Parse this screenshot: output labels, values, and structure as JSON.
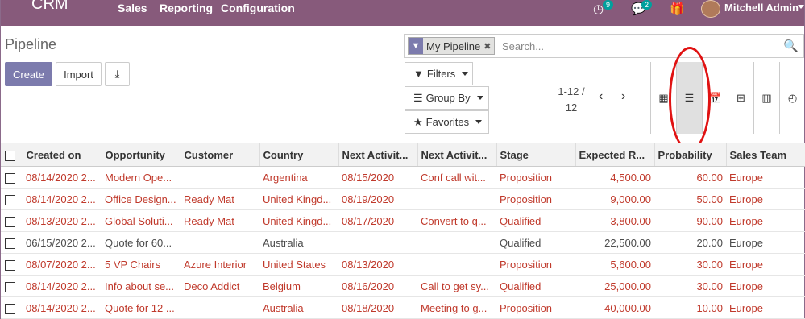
{
  "nav": {
    "brand": "CRM",
    "menus": [
      "Sales",
      "Reporting",
      "Configuration"
    ],
    "activity_badge": "9",
    "message_badge": "2",
    "user_name": "Mitchell Admin"
  },
  "control": {
    "title": "Pipeline",
    "create_label": "Create",
    "import_label": "Import",
    "search_facet": "My Pipeline",
    "search_placeholder": "Search...",
    "filters_label": "Filters",
    "groupby_label": "Group By",
    "favorites_label": "Favorites",
    "pager_top": "1-12 /",
    "pager_bottom": "12"
  },
  "views": [
    "kanban-icon",
    "list-icon",
    "calendar-icon",
    "pivot-icon",
    "graph-icon",
    "activity-icon"
  ],
  "table": {
    "columns": [
      "Created on",
      "Opportunity",
      "Customer",
      "Country",
      "Next Activit...",
      "Next Activit...",
      "Stage",
      "Expected R...",
      "Probability",
      "Sales Team"
    ],
    "rows": [
      {
        "overdue": true,
        "cells": [
          "08/14/2020 2...",
          "Modern Ope...",
          "",
          "Argentina",
          "08/15/2020",
          "Conf call wit...",
          "Proposition",
          "4,500.00",
          "60.00",
          "Europe"
        ]
      },
      {
        "overdue": true,
        "cells": [
          "08/14/2020 2...",
          "Office Design...",
          "Ready Mat",
          "United Kingd...",
          "08/19/2020",
          "",
          "Proposition",
          "9,000.00",
          "50.00",
          "Europe"
        ]
      },
      {
        "overdue": true,
        "cells": [
          "08/13/2020 2...",
          "Global Soluti...",
          "Ready Mat",
          "United Kingd...",
          "08/17/2020",
          "Convert to q...",
          "Qualified",
          "3,800.00",
          "90.00",
          "Europe"
        ]
      },
      {
        "overdue": false,
        "cells": [
          "06/15/2020 2...",
          "Quote for 60...",
          "",
          "Australia",
          "",
          "",
          "Qualified",
          "22,500.00",
          "20.00",
          "Europe"
        ]
      },
      {
        "overdue": true,
        "cells": [
          "08/07/2020 2...",
          "5 VP Chairs",
          "Azure Interior",
          "United States",
          "08/13/2020",
          "",
          "Proposition",
          "5,600.00",
          "30.00",
          "Europe"
        ]
      },
      {
        "overdue": true,
        "cells": [
          "08/14/2020 2...",
          "Info about se...",
          "Deco Addict",
          "Belgium",
          "08/16/2020",
          "Call to get sy...",
          "Qualified",
          "25,000.00",
          "30.00",
          "Europe"
        ]
      },
      {
        "overdue": true,
        "cells": [
          "08/14/2020 2...",
          "Quote for 12 ...",
          "",
          "Australia",
          "08/18/2020",
          "Meeting to g...",
          "Proposition",
          "40,000.00",
          "10.00",
          "Europe"
        ]
      }
    ]
  }
}
